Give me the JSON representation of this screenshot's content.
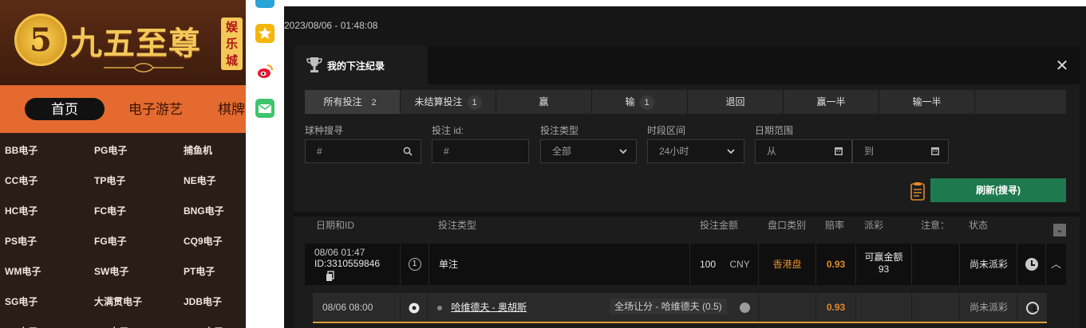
{
  "site": {
    "logo_glyph": "5",
    "brand_name": "九五至尊",
    "brand_sub": "娱乐城",
    "nav": {
      "home": "首页",
      "slots": "电子游艺",
      "chess": "棋牌"
    },
    "games": [
      "BB电子",
      "PG电子",
      "捕鱼机",
      "CC电子",
      "TP电子",
      "NE电子",
      "HC电子",
      "FC电子",
      "BNG电子",
      "PS电子",
      "FG电子",
      "CQ9电子",
      "WM电子",
      "SW电子",
      "PT电子",
      "SG电子",
      "大满贯电子",
      "JDB电子",
      "HB电子",
      "MG电子",
      "ONS电子"
    ]
  },
  "timestamp": "2023/08/06 - 01:48:08",
  "modal": {
    "title": "我的下注纪录",
    "close": "✕",
    "tabs": [
      {
        "label": "所有投注",
        "count": "2"
      },
      {
        "label": "未结算投注",
        "count": "1"
      },
      {
        "label": "赢",
        "count": ""
      },
      {
        "label": "输",
        "count": "1"
      },
      {
        "label": "退回",
        "count": ""
      },
      {
        "label": "赢一半",
        "count": ""
      },
      {
        "label": "输一半",
        "count": ""
      }
    ],
    "filters": {
      "sport_label": "球种搜寻",
      "sport_placeholder": "#",
      "betid_label": "投注 id:",
      "betid_placeholder": "#",
      "bettype_label": "投注类型",
      "bettype_value": "全部",
      "period_label": "时段区间",
      "period_value": "24小时",
      "date_label": "日期范围",
      "date_from": "从",
      "date_to": "到"
    },
    "refresh_label": "刷新(搜寻)",
    "columns": [
      "日期和ID",
      "投注类型",
      "投注金额",
      "盘口类别",
      "赔率",
      "派彩",
      "注意：",
      "状态"
    ],
    "bet": {
      "date": "08/06 01:47",
      "id": "ID:3310559846",
      "index": "1",
      "type": "单注",
      "amount": "100",
      "currency": "CNY",
      "odds_type": "香港盘",
      "odds": "0.93",
      "payout_label": "可赢金额",
      "payout_value": "93",
      "status": "尚未派彩"
    },
    "selection": {
      "date": "08/06 08:00",
      "match": "哈维德夫 - 奥胡斯",
      "market": "全场让分 - 哈维德夫 (0.5)",
      "odds": "0.93",
      "status": "尚未派彩"
    }
  },
  "colors": {
    "accent_green": "#1e7a4e",
    "odds_orange": "#e08a2a",
    "nav_orange": "#e46a2f"
  }
}
